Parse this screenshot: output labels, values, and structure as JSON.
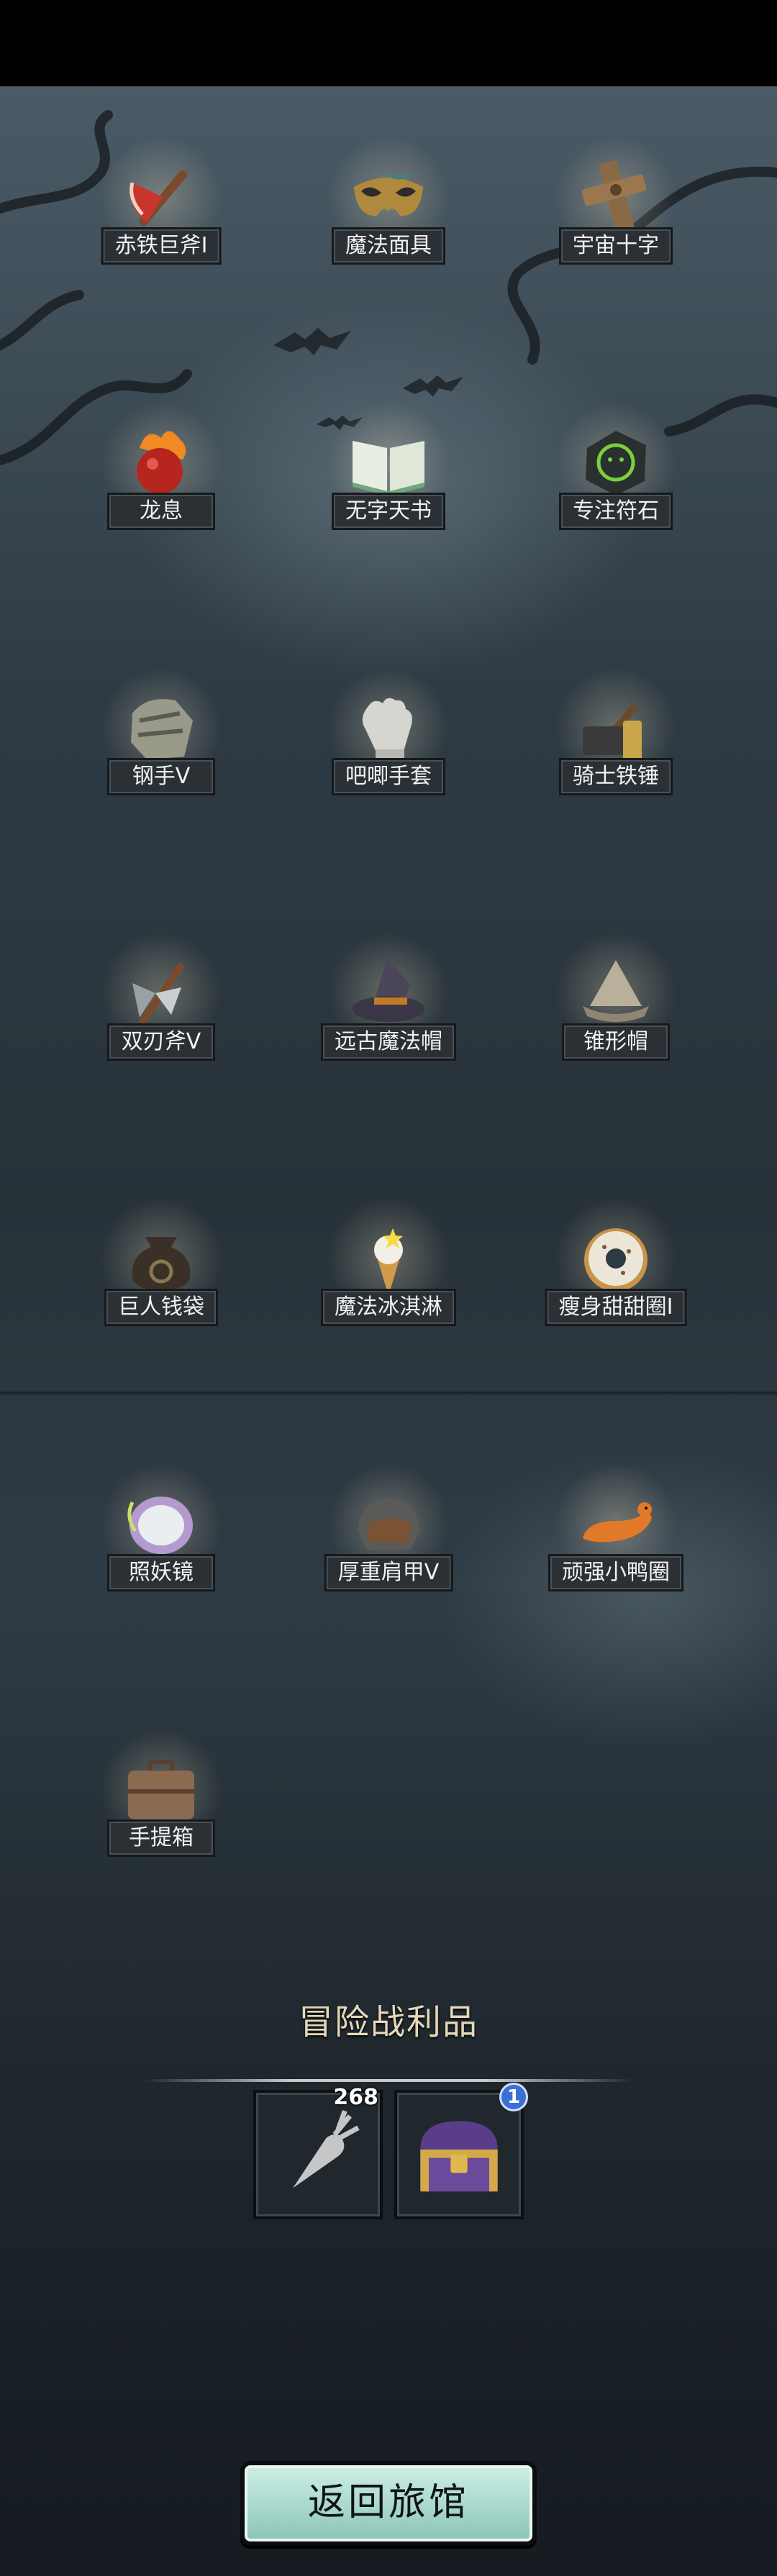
{
  "items": [
    {
      "name": "赤铁巨斧I",
      "icon": "red-axe-icon"
    },
    {
      "name": "魔法面具",
      "icon": "magic-mask-icon"
    },
    {
      "name": "宇宙十字",
      "icon": "cosmic-cross-icon"
    },
    {
      "name": "龙息",
      "icon": "dragon-breath-icon"
    },
    {
      "name": "无字天书",
      "icon": "blank-book-icon"
    },
    {
      "name": "专注符石",
      "icon": "focus-rune-icon"
    },
    {
      "name": "钢手V",
      "icon": "steel-gauntlet-icon"
    },
    {
      "name": "吧唧手套",
      "icon": "glove-icon"
    },
    {
      "name": "骑士铁锤",
      "icon": "knight-hammer-icon"
    },
    {
      "name": "双刃斧V",
      "icon": "double-axe-icon"
    },
    {
      "name": "远古魔法帽",
      "icon": "wizard-hat-icon"
    },
    {
      "name": "锥形帽",
      "icon": "cone-helmet-icon"
    },
    {
      "name": "巨人钱袋",
      "icon": "money-bag-icon"
    },
    {
      "name": "魔法冰淇淋",
      "icon": "ice-cream-icon"
    },
    {
      "name": "瘦身甜甜圈I",
      "icon": "donut-icon"
    },
    {
      "name": "照妖镜",
      "icon": "mirror-icon"
    },
    {
      "name": "厚重肩甲V",
      "icon": "pauldron-icon"
    },
    {
      "name": "顽强小鸭圈",
      "icon": "duck-ring-icon"
    },
    {
      "name": "手提箱",
      "icon": "suitcase-icon"
    }
  ],
  "loot": {
    "title": "冒险战利品",
    "slots": [
      {
        "icon": "carrot-icon",
        "count": "268"
      },
      {
        "icon": "treasure-chest-icon",
        "count": "1"
      }
    ]
  },
  "return_button": {
    "label": "返回旅馆"
  },
  "colors": {
    "label_bg": "#2b3035",
    "title": "#e4d8b8",
    "button": "#a8d8cc"
  }
}
